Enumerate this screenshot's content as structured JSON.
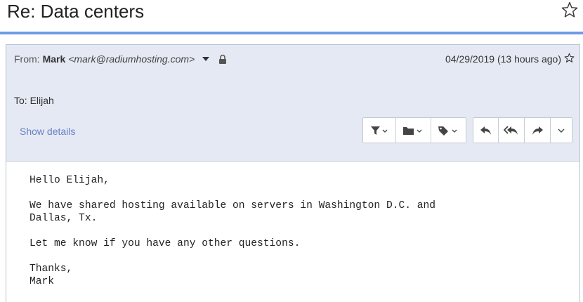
{
  "subject": "Re: Data centers",
  "header": {
    "from_label": "From:",
    "from_name": "Mark",
    "from_email": "<mark@radiumhosting.com>",
    "date": "04/29/2019 (13 hours ago)",
    "to": "To: Elijah",
    "show_details": "Show details"
  },
  "toolbar": {
    "icons": [
      "filter-icon",
      "folder-icon",
      "tag-icon",
      "reply-icon",
      "reply-all-icon",
      "forward-icon",
      "more-icon"
    ]
  },
  "body": {
    "lines": "Hello Elijah,\n\nWe have shared hosting available on servers in Washington D.C. and\nDallas, Tx.\n\nLet me know if you have any other questions.\n\nThanks,\nMark"
  },
  "colors": {
    "accent_rule": "#6e9be6",
    "header_bg": "#e4e9f3",
    "link": "#6a7fc7"
  }
}
